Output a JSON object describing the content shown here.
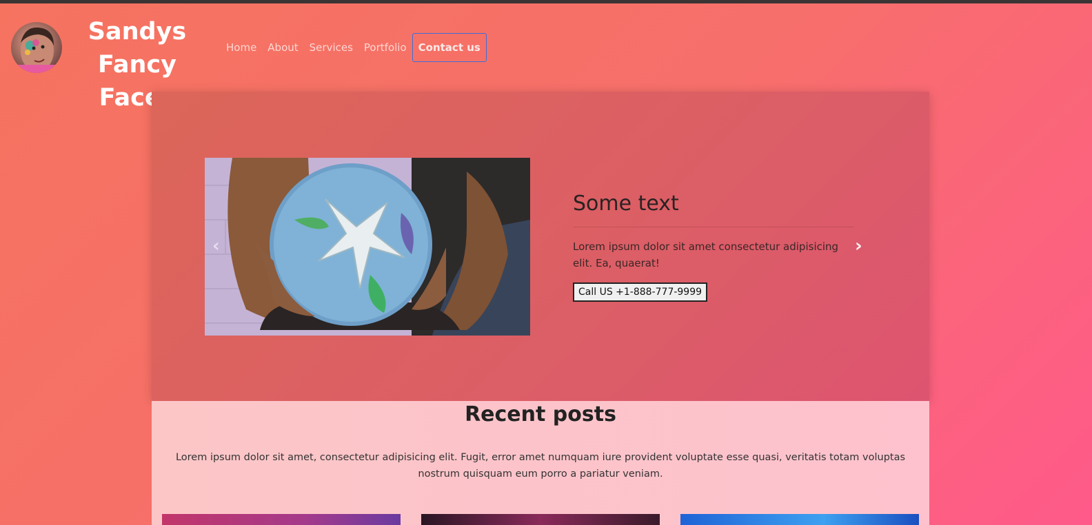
{
  "brand": {
    "title": "Sandys Fancy Faces"
  },
  "nav": {
    "items": [
      "Home",
      "About",
      "Services",
      "Portfolio"
    ],
    "contact_label": "Contact us"
  },
  "carousel": {
    "heading": "Some text",
    "text": "Lorem ipsum dolor sit amet consectetur adipisicing elit. Ea, quaerat!",
    "call_button": "Call US +1-888-777-9999",
    "prev_icon": "‹",
    "next_icon": "›"
  },
  "recent": {
    "title": "Recent posts",
    "description": "Lorem ipsum dolor sit amet, consectetur adipisicing elit. Fugit, error amet numquam iure provident voluptate esse quasi, veritatis totam voluptas nostrum quisquam eum porro a pariatur veniam."
  }
}
